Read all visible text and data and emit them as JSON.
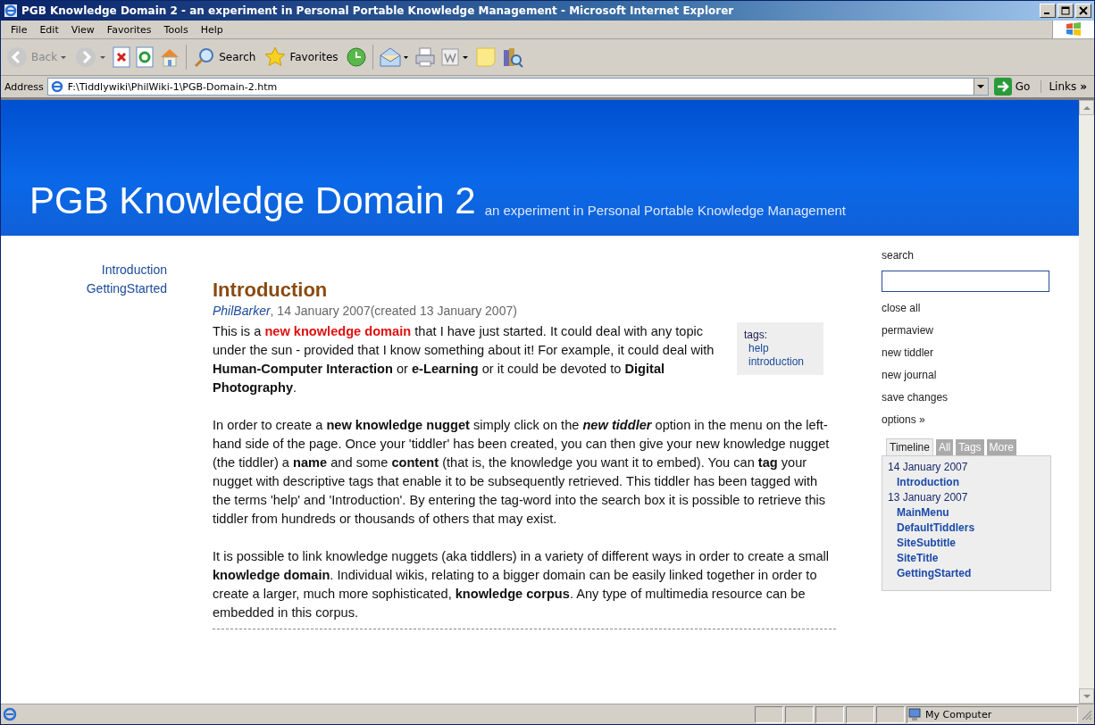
{
  "window": {
    "title": "PGB Knowledge Domain 2 - an experiment in Personal Portable Knowledge Management - Microsoft Internet Explorer"
  },
  "menu": [
    "File",
    "Edit",
    "View",
    "Favorites",
    "Tools",
    "Help"
  ],
  "toolbar": {
    "back": {
      "label": "Back",
      "disabled": true
    },
    "forward": {
      "disabled": true
    },
    "search": {
      "label": "Search"
    },
    "favorites": {
      "label": "Favorites"
    }
  },
  "address": {
    "label": "Address",
    "value": "F:\\Tiddlywiki\\PhilWiki-1\\PGB-Domain-2.htm",
    "go": "Go",
    "links": "Links",
    "links_more": "»"
  },
  "site": {
    "title": "PGB Knowledge Domain 2",
    "subtitle": "an experiment in Personal Portable Knowledge Management"
  },
  "main_menu": [
    "Introduction",
    "GettingStarted"
  ],
  "tiddler": {
    "title": "Introduction",
    "author": "PhilBarker",
    "meta": ", 14 January 2007(created 13 January 2007)",
    "tags_label": "tags:",
    "tags": [
      "help",
      "introduction"
    ],
    "paragraphs": [
      [
        {
          "text": "This is a ",
          "kind": "plain"
        },
        {
          "text": "new knowledge domain",
          "kind": "highlight"
        },
        {
          "text": " that I have just started. It could deal with any topic under the sun - provided that I know something about it! For example, it could deal with ",
          "kind": "plain"
        },
        {
          "text": "Human-Computer Interaction",
          "kind": "strong"
        },
        {
          "text": " or ",
          "kind": "plain"
        },
        {
          "text": "e-Learning",
          "kind": "strong"
        },
        {
          "text": " or it could be devoted to ",
          "kind": "plain"
        },
        {
          "text": "Digital Photography",
          "kind": "strong"
        },
        {
          "text": ".",
          "kind": "plain"
        }
      ],
      [
        {
          "text": "In order to create a ",
          "kind": "plain"
        },
        {
          "text": "new knowledge nugget",
          "kind": "strong"
        },
        {
          "text": " simply click on the ",
          "kind": "plain"
        },
        {
          "text": "new tiddler",
          "kind": "emphasis"
        },
        {
          "text": " option in the menu on the left-hand side of the page. Once your 'tiddler' has been created, you can then give your new knowledge nugget (the tiddler) a ",
          "kind": "plain"
        },
        {
          "text": "name",
          "kind": "strong"
        },
        {
          "text": " and some ",
          "kind": "plain"
        },
        {
          "text": "content",
          "kind": "strong"
        },
        {
          "text": " (that is, the knowledge you want it to embed). You can ",
          "kind": "plain"
        },
        {
          "text": "tag",
          "kind": "strong"
        },
        {
          "text": " your nugget with descriptive tags that enable it to be subsequently retrieved. This tiddler has been tagged with the terms 'help' and 'Introduction'. By entering the tag-word into the search box it is possible to retrieve this tiddler from hundreds or thousands of others that may exist.",
          "kind": "plain"
        }
      ],
      [
        {
          "text": "It is possible to link knowledge nuggets (aka tiddlers) in a variety of different ways in order to create a small ",
          "kind": "plain"
        },
        {
          "text": "knowledge domain",
          "kind": "strong"
        },
        {
          "text": ". Individual wikis, relating to a bigger domain can be easily linked together in order to create a larger, much more sophisticated, ",
          "kind": "plain"
        },
        {
          "text": "knowledge corpus",
          "kind": "strong"
        },
        {
          "text": ". Any type of multimedia resource can be embedded in this corpus.",
          "kind": "plain"
        }
      ]
    ]
  },
  "sidebar": {
    "search_label": "search",
    "commands": [
      "close all",
      "permaview",
      "new tiddler",
      "new journal",
      "save changes",
      "options »"
    ],
    "tabs": [
      {
        "label": "Timeline",
        "selected": true
      },
      {
        "label": "All",
        "selected": false
      },
      {
        "label": "Tags",
        "selected": false
      },
      {
        "label": "More",
        "selected": false
      }
    ],
    "timeline": [
      {
        "date": "14 January 2007",
        "items": [
          "Introduction"
        ]
      },
      {
        "date": "13 January 2007",
        "items": [
          "MainMenu",
          "DefaultTiddlers",
          "SiteSubtitle",
          "SiteTitle",
          "GettingStarted"
        ]
      }
    ]
  },
  "status_bar": {
    "zone": "My Computer"
  }
}
